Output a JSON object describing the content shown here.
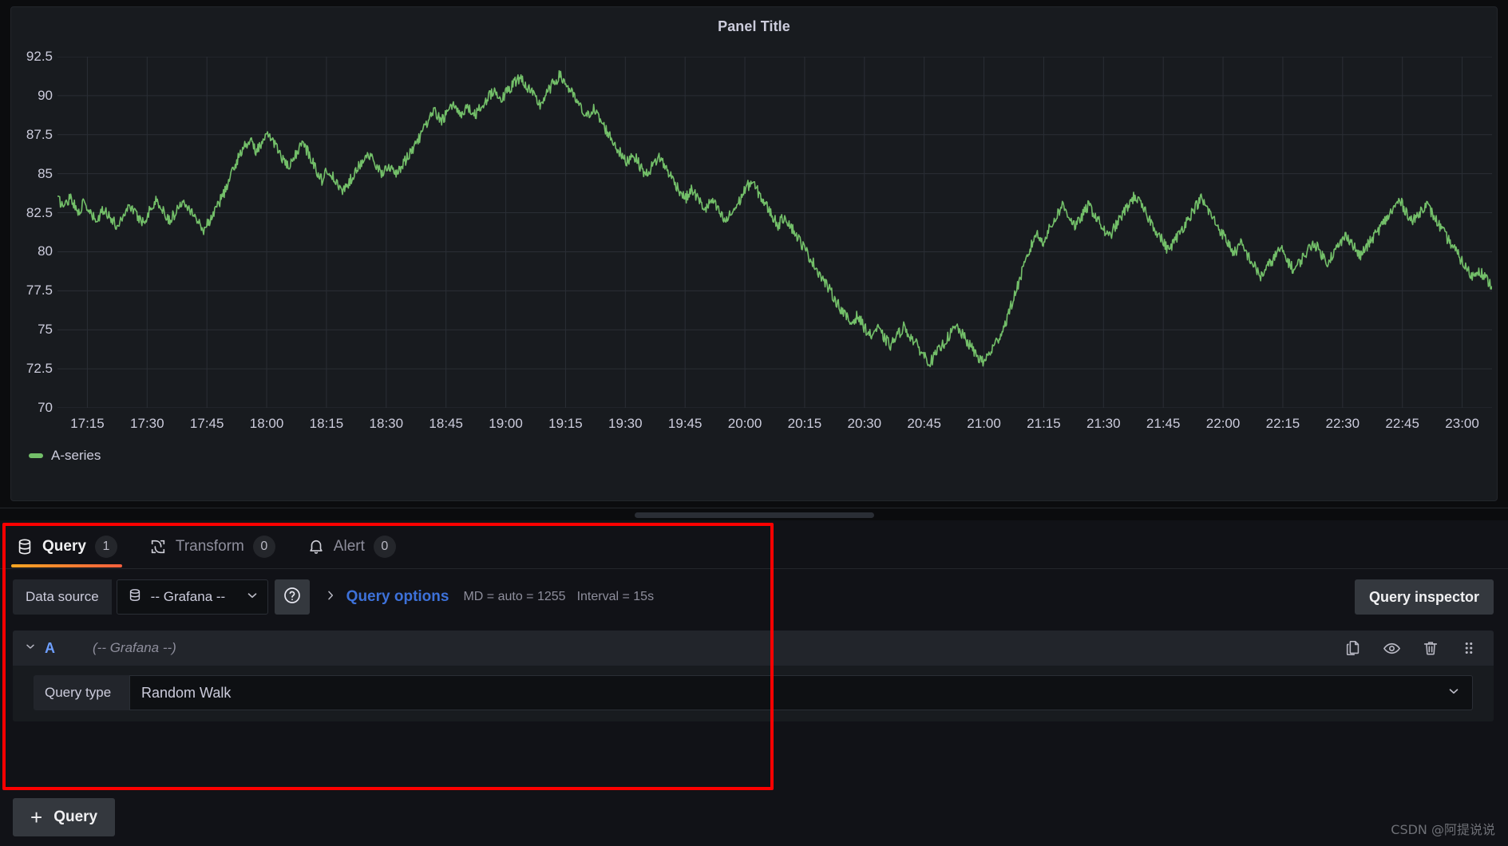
{
  "panel": {
    "title": "Panel Title",
    "series_name": "A-series",
    "series_color": "#73bf69"
  },
  "chart_data": {
    "type": "line",
    "title": "Panel Title",
    "xlabel": "",
    "ylabel": "",
    "ylim": [
      70,
      92.5
    ],
    "grid": true,
    "legend_position": "bottom-left",
    "y_ticks": [
      "92.5",
      "90",
      "87.5",
      "85",
      "82.5",
      "80",
      "77.5",
      "75",
      "72.5",
      "70"
    ],
    "x_ticks": [
      "17:15",
      "17:30",
      "17:45",
      "18:00",
      "18:15",
      "18:30",
      "18:45",
      "19:00",
      "19:15",
      "19:30",
      "19:45",
      "20:00",
      "20:15",
      "20:30",
      "20:45",
      "21:00",
      "21:15",
      "21:30",
      "21:45",
      "22:00",
      "22:15",
      "22:30",
      "22:45",
      "23:00"
    ],
    "series": [
      {
        "name": "A-series",
        "color": "#73bf69",
        "values": [
          83.4,
          82.9,
          83.6,
          82.5,
          83.1,
          82.4,
          81.9,
          82.8,
          82.2,
          81.6,
          82.4,
          83.0,
          82.3,
          81.9,
          82.7,
          83.3,
          82.6,
          82.0,
          82.6,
          83.4,
          82.8,
          82.1,
          81.4,
          82.0,
          82.8,
          83.6,
          84.6,
          85.7,
          86.6,
          87.2,
          86.5,
          86.9,
          87.6,
          86.8,
          86.0,
          85.3,
          86.2,
          87.0,
          86.3,
          85.4,
          84.6,
          85.3,
          84.5,
          83.8,
          84.4,
          85.1,
          85.8,
          86.3,
          85.6,
          85.0,
          85.6,
          84.9,
          85.4,
          86.1,
          86.8,
          87.5,
          88.3,
          89.0,
          88.4,
          88.9,
          89.4,
          88.8,
          89.3,
          88.7,
          89.2,
          89.8,
          90.4,
          89.8,
          90.2,
          90.8,
          91.2,
          90.6,
          90.0,
          89.4,
          90.1,
          90.8,
          91.3,
          90.7,
          90.0,
          89.3,
          88.6,
          89.2,
          88.5,
          87.8,
          87.1,
          86.4,
          85.7,
          86.3,
          85.6,
          84.9,
          85.5,
          86.1,
          85.4,
          84.7,
          84.0,
          83.4,
          84.0,
          83.3,
          82.7,
          83.3,
          82.6,
          81.9,
          82.5,
          83.1,
          84.0,
          84.5,
          83.8,
          83.1,
          82.4,
          81.7,
          82.3,
          81.6,
          80.9,
          80.2,
          79.5,
          78.8,
          78.1,
          77.4,
          76.7,
          76.0,
          75.4,
          75.9,
          75.2,
          74.6,
          75.1,
          74.5,
          74.0,
          74.6,
          75.2,
          74.6,
          74.0,
          73.4,
          72.9,
          73.5,
          74.1,
          74.7,
          75.2,
          74.6,
          74.0,
          73.4,
          72.9,
          73.5,
          74.2,
          75.0,
          76.2,
          77.5,
          78.8,
          80.0,
          81.2,
          80.6,
          81.4,
          82.2,
          83.0,
          82.3,
          81.6,
          82.3,
          83.0,
          82.3,
          81.6,
          80.9,
          81.6,
          82.3,
          83.0,
          83.6,
          82.9,
          82.2,
          81.5,
          80.8,
          80.1,
          80.7,
          81.4,
          82.1,
          82.8,
          83.4,
          82.7,
          82.0,
          81.3,
          80.6,
          79.9,
          80.5,
          79.8,
          79.1,
          78.4,
          79.0,
          79.6,
          80.2,
          79.5,
          78.8,
          79.4,
          80.0,
          80.6,
          80.0,
          79.3,
          79.9,
          80.5,
          81.1,
          80.4,
          79.7,
          80.3,
          80.9,
          81.5,
          82.1,
          82.7,
          83.3,
          82.6,
          81.9,
          82.5,
          83.1,
          82.4,
          81.7,
          81.0,
          80.4,
          79.7,
          79.0,
          78.4,
          78.9,
          78.3,
          77.8
        ]
      }
    ]
  },
  "tabs": [
    {
      "label": "Query",
      "count": "1",
      "icon": "database-icon",
      "active": true
    },
    {
      "label": "Transform",
      "count": "0",
      "icon": "transform-icon",
      "active": false
    },
    {
      "label": "Alert",
      "count": "0",
      "icon": "bell-icon",
      "active": false
    }
  ],
  "datasource_row": {
    "label": "Data source",
    "selected": "-- Grafana --",
    "help_icon": "question-circle-icon",
    "query_options_label": "Query options",
    "max_data_points": "MD = auto = 1255",
    "interval": "Interval = 15s",
    "inspector_label": "Query inspector"
  },
  "query": {
    "ref_id": "A",
    "datasource": "(-- Grafana --)",
    "actions": [
      "duplicate-icon",
      "eye-icon",
      "trash-icon",
      "drag-handle-icon"
    ],
    "field_label": "Query type",
    "field_value": "Random Walk"
  },
  "footer": {
    "add_query_label": "Query",
    "add_query_plus": "+"
  },
  "watermark": "CSDN @阿提说说",
  "colors": {
    "accent_orange": "#f5a623",
    "link_blue": "#3d71d9",
    "ref_blue": "#6e9fff",
    "highlight_red": "#fd0000",
    "series_green": "#73bf69"
  }
}
